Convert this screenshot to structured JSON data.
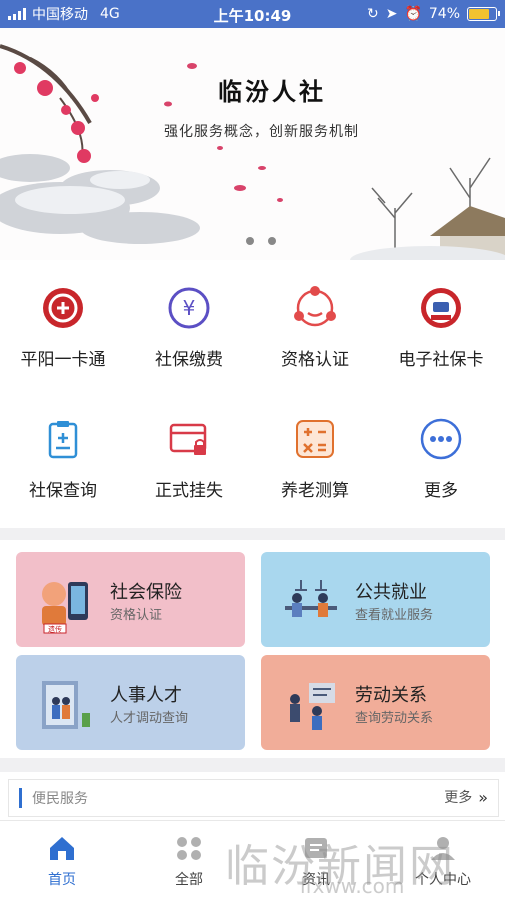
{
  "status_bar": {
    "carrier": "中国移动",
    "network": "4G",
    "time": "上午10:49",
    "battery": "74%",
    "battery_level": 0.74
  },
  "banner": {
    "title": "临汾人社",
    "subtitle": "强化服务概念，创新服务机制",
    "page_count": 2
  },
  "quick_grid": [
    {
      "label": "平阳一卡通",
      "icon": "card-logo-icon",
      "color": "#c8262b"
    },
    {
      "label": "社保缴费",
      "icon": "yuan-icon",
      "color": "#5b4fc4"
    },
    {
      "label": "资格认证",
      "icon": "user-network-icon",
      "color": "#e24b4b"
    },
    {
      "label": "电子社保卡",
      "icon": "social-security-badge-icon",
      "color": "#c8262b"
    },
    {
      "label": "社保查询",
      "icon": "clipboard-icon",
      "color": "#2f8fd6"
    },
    {
      "label": "正式挂失",
      "icon": "lock-card-icon",
      "color": "#d83a48"
    },
    {
      "label": "养老测算",
      "icon": "calculator-icon",
      "color": "#e0712e"
    },
    {
      "label": "更多",
      "icon": "more-dots-icon",
      "color": "#3d6fd8"
    }
  ],
  "cards": [
    {
      "title": "社会保险",
      "subtitle": "资格认证",
      "bg": "#f2bfc9",
      "tag": "遗传"
    },
    {
      "title": "公共就业",
      "subtitle": "查看就业服务",
      "bg": "#a9d7ee"
    },
    {
      "title": "人事人才",
      "subtitle": "人才调动查询",
      "bg": "#bcd0e9"
    },
    {
      "title": "劳动关系",
      "subtitle": "查询劳动关系",
      "bg": "#f1ad99"
    }
  ],
  "service_section": {
    "title": "便民服务",
    "more": "更多"
  },
  "tab_bar": [
    {
      "label": "首页",
      "icon": "home-icon",
      "active": true
    },
    {
      "label": "全部",
      "icon": "grid-icon",
      "active": false
    },
    {
      "label": "资讯",
      "icon": "news-icon",
      "active": false
    },
    {
      "label": "个人中心",
      "icon": "user-icon",
      "active": false
    }
  ],
  "watermark": {
    "text": "临汾新闻网",
    "url": "lfxww.com"
  },
  "colors": {
    "status_bar": "#4a72c8",
    "accent": "#2f6fd0",
    "tab_active": "#2f6fd0",
    "tab_inactive": "#9a9a9a"
  }
}
